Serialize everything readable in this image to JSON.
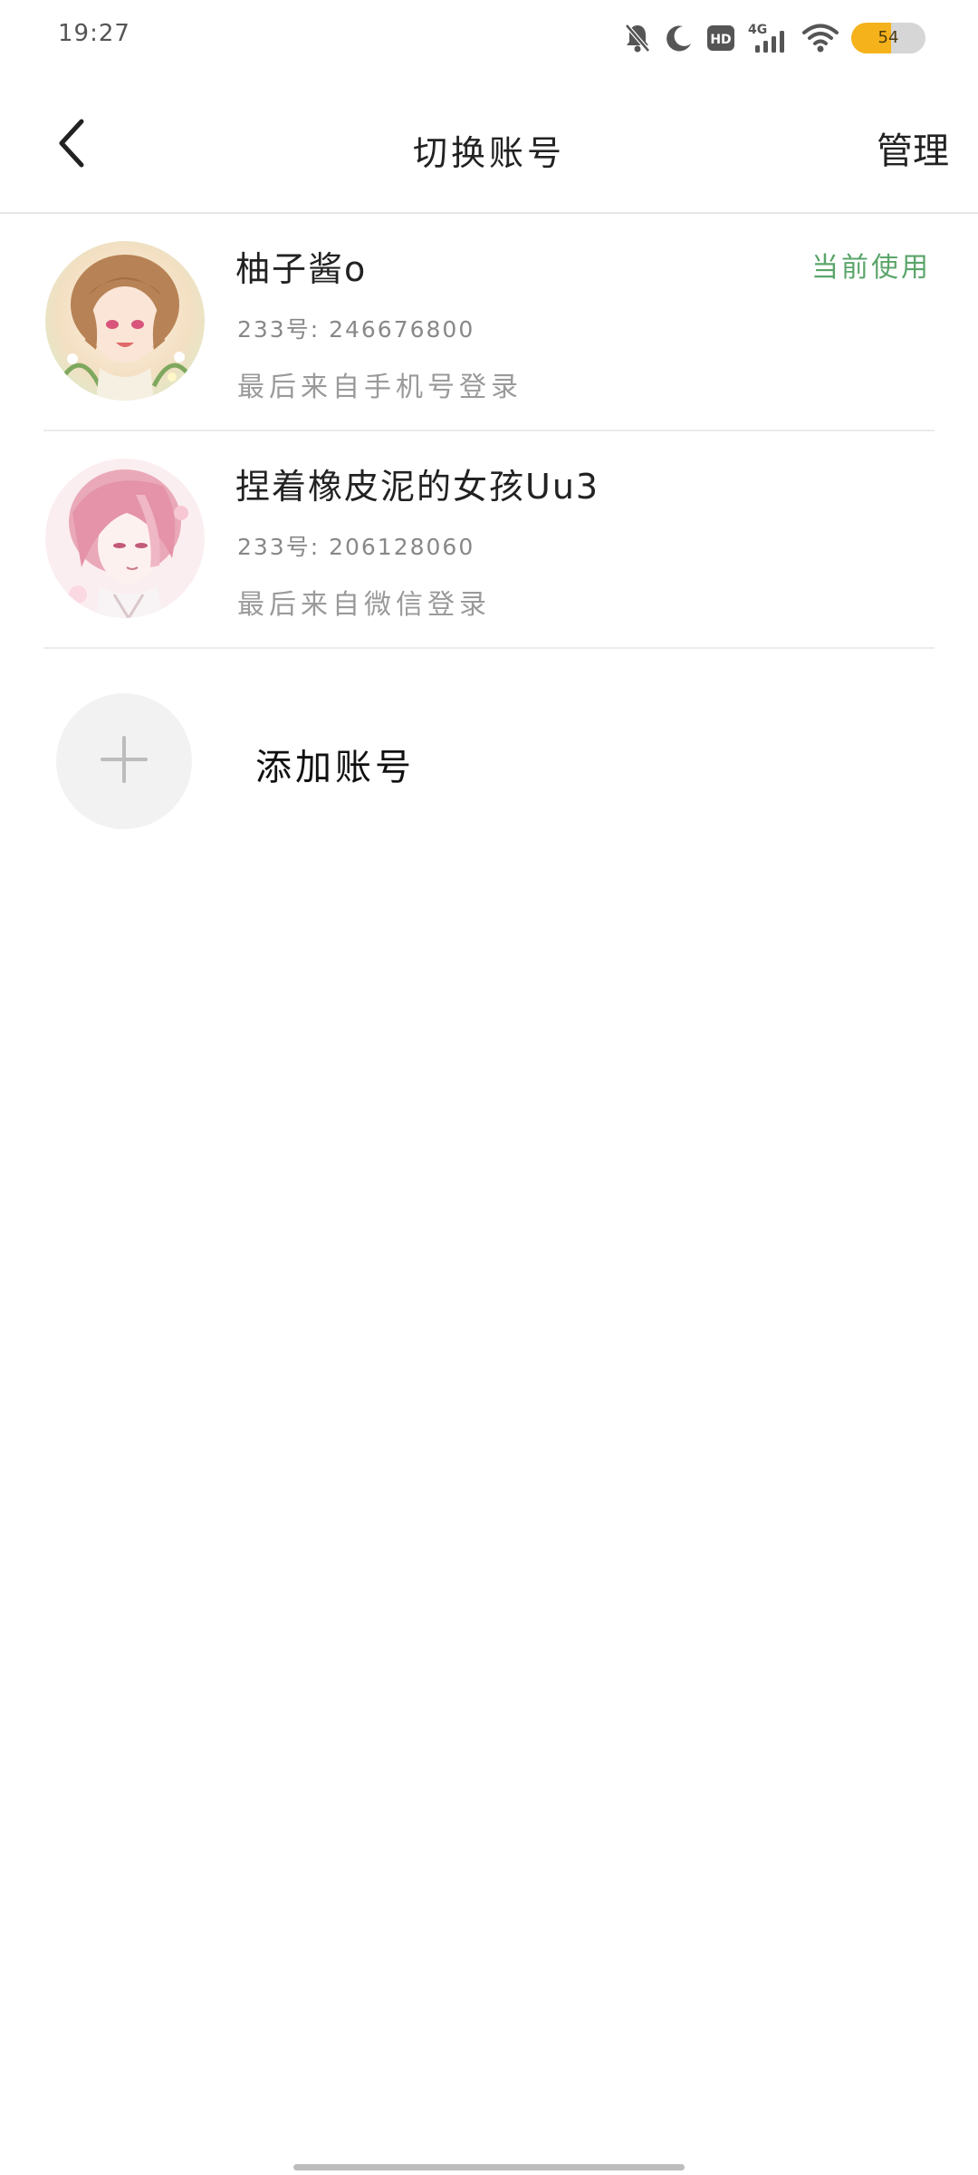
{
  "status_bar": {
    "time": "19:27",
    "network": "4G",
    "hd_label": "HD",
    "battery": "54",
    "battery_level": 0.54,
    "icons": [
      "bell-off-icon",
      "moon-icon",
      "hd-icon",
      "signal-4g-icon",
      "wifi-icon",
      "battery-icon"
    ]
  },
  "nav": {
    "title": "切换账号",
    "manage_label": "管理",
    "back_icon": "chevron-left-icon"
  },
  "accounts": [
    {
      "name": "柚子酱o",
      "id_line": "233号: 246676800",
      "login_line": "最后来自手机号登录",
      "badge": "当前使用"
    },
    {
      "name": "捏着橡皮泥的女孩Uu3",
      "id_line": "233号: 206128060",
      "login_line": "最后来自微信登录"
    }
  ],
  "add_account": {
    "label": "添加账号",
    "icon": "plus-icon"
  },
  "colors": {
    "accent_green": "#5aa56a",
    "battery": "#f6b21b",
    "divider": "#ececec"
  }
}
